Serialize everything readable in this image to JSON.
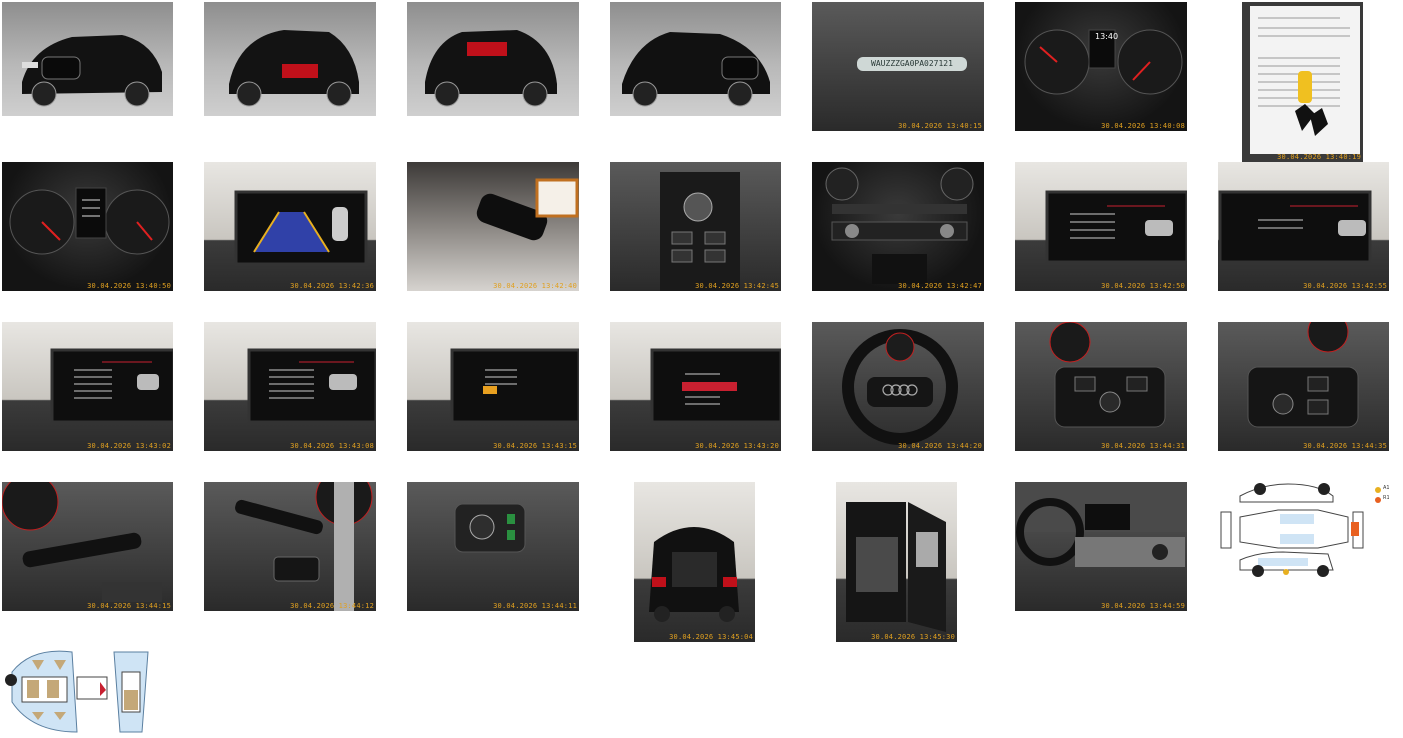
{
  "gallery": {
    "photos": [
      {
        "name": "front-left-exterior",
        "stamp": ""
      },
      {
        "name": "rear-left-exterior",
        "stamp": ""
      },
      {
        "name": "rear-right-exterior",
        "stamp": ""
      },
      {
        "name": "front-right-exterior",
        "stamp": ""
      },
      {
        "name": "vin-plate",
        "stamp": "30.04.2026 13:40:15",
        "vin": "WAUZZZGA0PA027121"
      },
      {
        "name": "instrument-cluster-time",
        "stamp": "30.04.2026 13:40:08"
      },
      {
        "name": "service-documents-keys",
        "stamp": "30.04.2026 13:40:19"
      },
      {
        "name": "instrument-cluster-service",
        "stamp": "30.04.2026 13:40:50"
      },
      {
        "name": "reverse-camera-screen",
        "stamp": "30.04.2026 13:42:36"
      },
      {
        "name": "interior-mirror",
        "stamp": "30.04.2026 13:42:40"
      },
      {
        "name": "center-console-controls",
        "stamp": "30.04.2026 13:42:45"
      },
      {
        "name": "climate-controls",
        "stamp": "30.04.2026 13:42:47"
      },
      {
        "name": "infotainment-service-menu",
        "stamp": "30.04.2026 13:42:50"
      },
      {
        "name": "infotainment-vehicle-menu",
        "stamp": "30.04.2026 13:42:55"
      },
      {
        "name": "infotainment-settings-1",
        "stamp": "30.04.2026 13:43:02"
      },
      {
        "name": "infotainment-settings-2",
        "stamp": "30.04.2026 13:43:08"
      },
      {
        "name": "infotainment-functions",
        "stamp": "30.04.2026 13:43:15"
      },
      {
        "name": "infotainment-connect",
        "stamp": "30.04.2026 13:43:20"
      },
      {
        "name": "steering-wheel",
        "stamp": "30.04.2026 13:44:20"
      },
      {
        "name": "steering-wheel-right-buttons",
        "stamp": "30.04.2026 13:44:31"
      },
      {
        "name": "steering-wheel-left-buttons",
        "stamp": "30.04.2026 13:44:35"
      },
      {
        "name": "wiper-stalk",
        "stamp": "30.04.2026 13:44:15"
      },
      {
        "name": "indicator-stalk",
        "stamp": "30.04.2026 13:44:12"
      },
      {
        "name": "light-switch",
        "stamp": "30.04.2026 13:44:11"
      },
      {
        "name": "open-trunk",
        "stamp": "30.04.2026 13:45:04"
      },
      {
        "name": "rear-door-open",
        "stamp": "30.04.2026 13:45:30"
      },
      {
        "name": "dashboard-interior",
        "stamp": "30.04.2026 13:44:59"
      },
      {
        "name": "damage-diagram-exterior",
        "stamp": ""
      },
      {
        "name": "damage-diagram-interior",
        "stamp": ""
      }
    ],
    "cluster_time": "13:40",
    "legend": [
      "A1",
      "R1"
    ]
  }
}
